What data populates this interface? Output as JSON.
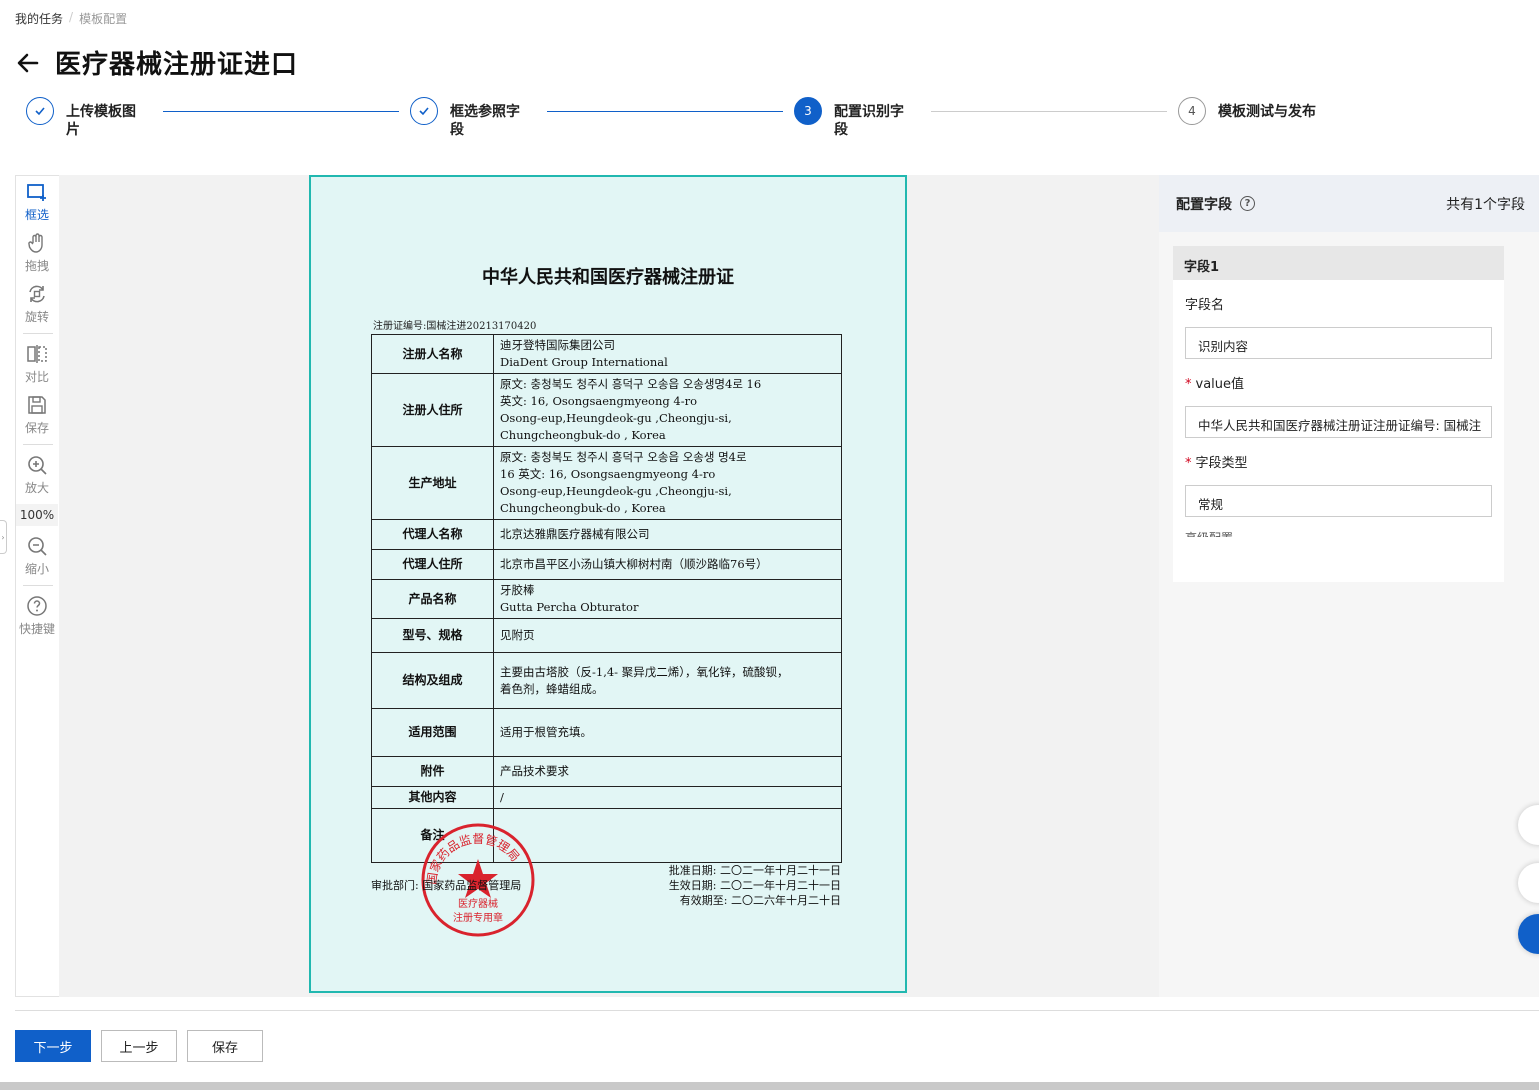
{
  "breadcrumb": {
    "home": "我的任务",
    "current": "模板配置"
  },
  "page": {
    "title": "医疗器械注册证进口"
  },
  "steps": [
    {
      "label": "上传模板图片",
      "state": "done"
    },
    {
      "label": "框选参照字段",
      "state": "done"
    },
    {
      "label": "配置识别字段",
      "state": "active",
      "number": "3"
    },
    {
      "label": "模板测试与发布",
      "state": "pending",
      "number": "4"
    }
  ],
  "toolbar": {
    "select": "框选",
    "drag": "拖拽",
    "rotate": "旋转",
    "compare": "对比",
    "save": "保存",
    "zoom_in": "放大",
    "zoom_level": "100%",
    "zoom_out": "缩小",
    "shortcuts": "快捷键"
  },
  "document": {
    "title": "中华人民共和国医疗器械注册证",
    "reg_no": "注册证编号:国械注进20213170420",
    "rows": [
      {
        "k": "注册人名称",
        "v": [
          "迪牙登特国际集团公司",
          "DiaDent Group International"
        ]
      },
      {
        "k": "注册人住所",
        "v": [
          "原文: 충청북도 청주시 흥덕구 오송읍 오송생명4로 16",
          "英文: 16, Osongsaengmyeong 4-ro",
          "Osong-eup,Heungdeok-gu ,Cheongju-si,",
          "Chungcheongbuk-do , Korea"
        ]
      },
      {
        "k": "生产地址",
        "v": [
          "原文: 충청북도 청주시 흥덕구 오송읍 오송생 명4로",
          "16 英文: 16, Osongsaengmyeong 4-ro",
          "Osong-eup,Heungdeok-gu ,Cheongju-si,",
          "Chungcheongbuk-do , Korea"
        ]
      },
      {
        "k": "代理人名称",
        "v": [
          "北京达雅鼎医疗器械有限公司"
        ]
      },
      {
        "k": "代理人住所",
        "v": [
          "北京市昌平区小汤山镇大柳树村南（顺沙路临76号）"
        ]
      },
      {
        "k": "产品名称",
        "v": [
          "牙胶棒",
          "Gutta Percha Obturator"
        ]
      },
      {
        "k": "型号、规格",
        "v": [
          "见附页"
        ]
      },
      {
        "k": "结构及组成",
        "v": [
          "主要由古塔胶（反-1,4- 聚异戊二烯），氧化锌，硫酸钡，",
          "着色剂，蜂蜡组成。"
        ]
      },
      {
        "k": "适用范围",
        "v": [
          "适用于根管充填。"
        ]
      },
      {
        "k": "附件",
        "v": [
          "产品技术要求"
        ]
      },
      {
        "k": "其他内容",
        "v": [
          "/"
        ]
      },
      {
        "k": "备注",
        "v": [
          ""
        ]
      }
    ],
    "authority": "审批部门: 国家药品监督管理局",
    "approve_date": "批准日期: 二〇二一年十月二十一日",
    "effective_date": "生效日期: 二〇二一年十月二十一日",
    "expiry_date": "有效期至: 二〇二六年十月二十日",
    "stamp_outer": "国家药品监督管理局",
    "stamp_inner_1": "医疗器械",
    "stamp_inner_2": "注册专用章"
  },
  "panel": {
    "title": "配置字段",
    "count": "共有1个字段",
    "field": {
      "header": "字段1",
      "name_label": "字段名",
      "name_value": "识别内容",
      "value_label": "value值",
      "value_value": "中华人民共和国医疗器械注册证注册证编号: 国械注",
      "type_label": "字段类型",
      "type_value": "常规",
      "more_label": "高级配置"
    }
  },
  "footer": {
    "next": "下一步",
    "prev": "上一步",
    "save": "保存"
  },
  "colors": {
    "primary": "#1060c9",
    "doc_bg": "#e2f6f5",
    "doc_border": "#21b8b0",
    "stamp": "#d9232d"
  }
}
